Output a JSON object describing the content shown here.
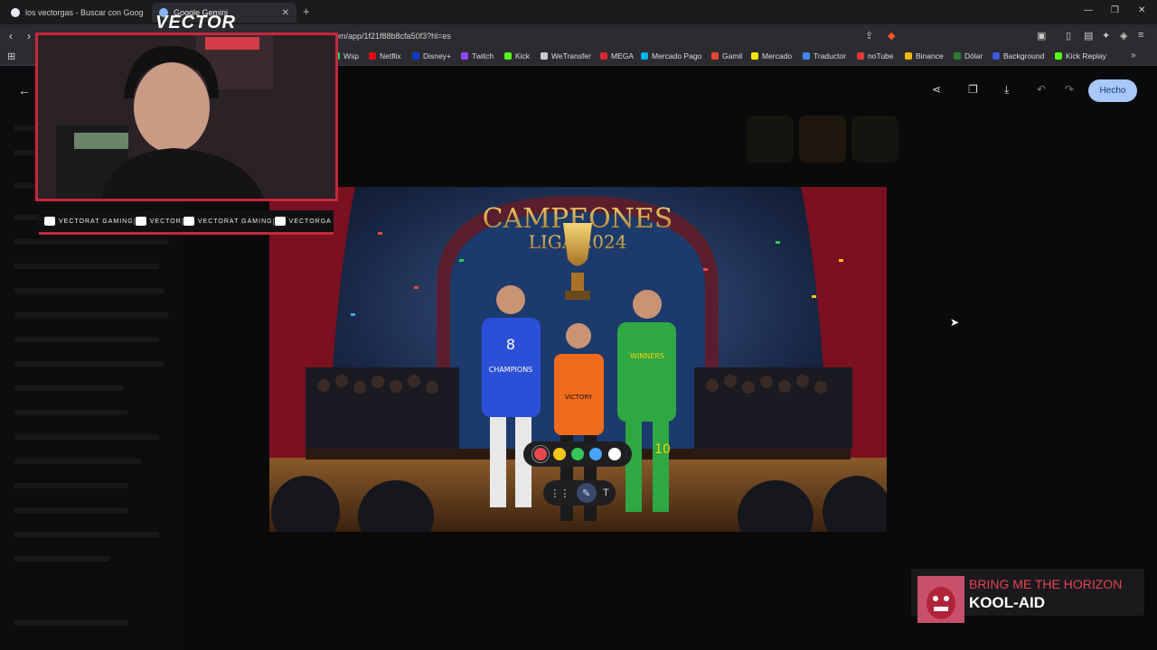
{
  "tabs": [
    {
      "label": "los vectorgas - Buscar con Google",
      "favicon_color": "#e8eaed"
    },
    {
      "label": "Google Gemini",
      "favicon_color": "#8ab4f8"
    }
  ],
  "address": {
    "url": "om/app/1f21f88b8cfa50f3?hl=es"
  },
  "bookmarks": [
    {
      "label": "Wsp",
      "color": "#25d366"
    },
    {
      "label": "Netflix",
      "color": "#e50914"
    },
    {
      "label": "Disney+",
      "color": "#113ccf"
    },
    {
      "label": "Twitch",
      "color": "#9146ff"
    },
    {
      "label": "Kick",
      "color": "#53fc18"
    },
    {
      "label": "WeTransfer",
      "color": "#cccccc"
    },
    {
      "label": "MEGA",
      "color": "#d9272e"
    },
    {
      "label": "Mercado Pago",
      "color": "#00b1ea"
    },
    {
      "label": "Gamil",
      "color": "#ea4335"
    },
    {
      "label": "Mercado",
      "color": "#ffe600"
    },
    {
      "label": "Traductor",
      "color": "#4285f4"
    },
    {
      "label": "noTube",
      "color": "#e53935"
    },
    {
      "label": "Binance",
      "color": "#f0b90b"
    },
    {
      "label": "Dólar",
      "color": "#2e7d32"
    },
    {
      "label": "Background",
      "color": "#3b5bdb"
    },
    {
      "label": "Kick Replay",
      "color": "#53fc18"
    }
  ],
  "viewer": {
    "done_label": "Hecho"
  },
  "streamer": {
    "name": "VECTOR",
    "socials": [
      {
        "label": "VECTORAT GAMING",
        "color": "#ffffff"
      },
      {
        "label": "VECTOR",
        "color": "#ffffff"
      },
      {
        "label": "VECTORAT GAMING",
        "color": "#ffffff"
      },
      {
        "label": "VECTORGA",
        "color": "#ffffff"
      }
    ]
  },
  "image": {
    "banner_line1": "CAMPEONES",
    "banner_line2": "LIGA 2024",
    "jersey_left": "8",
    "jersey_left_text": "CHAMPIONS",
    "jersey_center_text": "VICTORY",
    "jersey_right": "10",
    "jersey_right_text": "WINNERS"
  },
  "palette_colors": [
    "#e5484d",
    "#f5c518",
    "#36c75a",
    "#4aa3ff",
    "#ffffff"
  ],
  "now_playing": {
    "artist": "BRING ME THE HORIZON",
    "track": "KOOL-AID"
  }
}
